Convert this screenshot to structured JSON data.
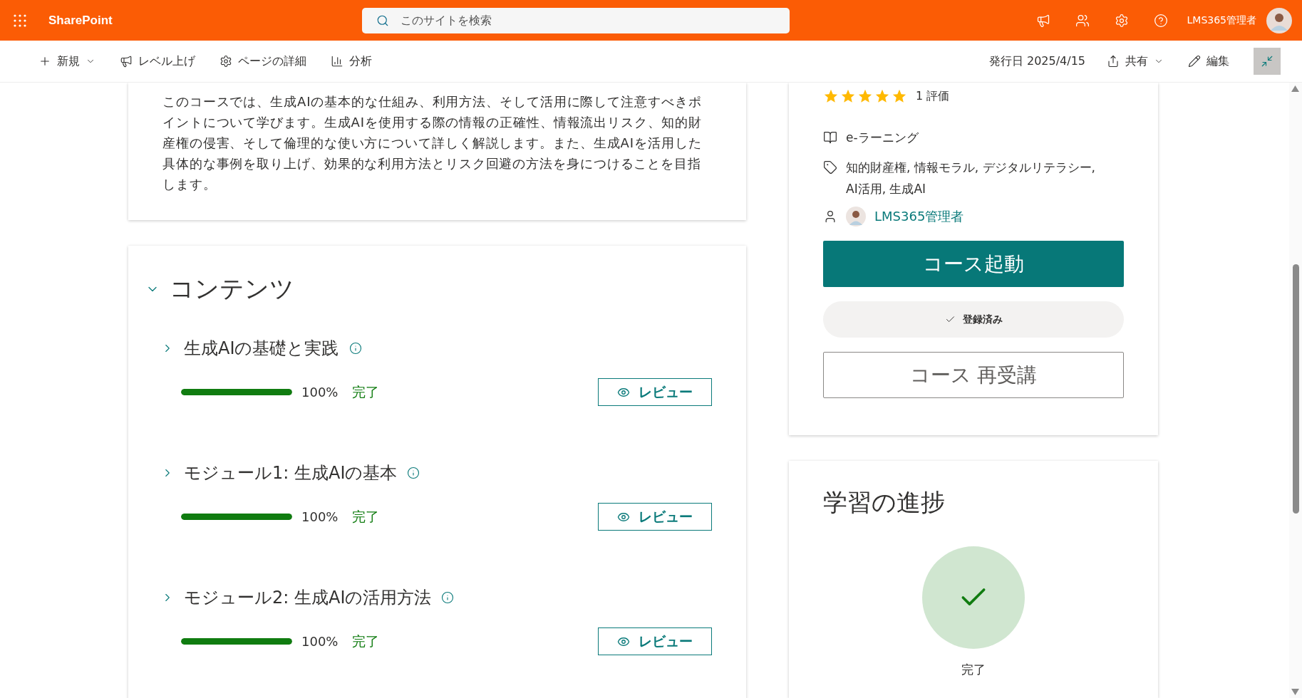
{
  "header": {
    "app_name": "SharePoint",
    "search_placeholder": "このサイトを検索",
    "user_name": "LMS365管理者"
  },
  "command_bar": {
    "left": [
      {
        "kind": "new",
        "label": "新規",
        "dropdown": true
      },
      {
        "kind": "promote",
        "label": "レベル上げ",
        "dropdown": false
      },
      {
        "kind": "details",
        "label": "ページの詳細",
        "dropdown": false
      },
      {
        "kind": "analytics",
        "label": "分析",
        "dropdown": false
      }
    ],
    "published": "発行日 2025/4/15",
    "share": "共有",
    "edit": "編集"
  },
  "description": "このコースでは、生成AIの基本的な仕組み、利用方法、そして活用に際して注意すべきポイントについて学びます。生成AIを使用する際の情報の正確性、情報流出リスク、知的財産権の侵害、そして倫理的な使い方について詳しく解説します。また、生成AIを活用した具体的な事例を取り上げ、効果的な利用方法とリスク回避の方法を身につけることを目指します。",
  "contents": {
    "title": "コンテンツ",
    "expanded": true,
    "modules": [
      {
        "title": "生成AIの基礎と実践",
        "level": 1,
        "percent": "100%",
        "status": "完了",
        "button": "レビュー"
      },
      {
        "title": "モジュール1: 生成AIの基本",
        "level": 1,
        "percent": "100%",
        "status": "完了",
        "button": "レビュー"
      },
      {
        "title": "モジュール2: 生成AIの活用方法",
        "level": 1,
        "percent": "100%",
        "status": "完了",
        "button": "レビュー"
      }
    ]
  },
  "course_info": {
    "stars": 5,
    "rating_text": "1 評価",
    "type": "e-ラーニング",
    "tags": "知的財産権, 情報モラル, デジタルリテラシー, AI活用, 生成AI",
    "author": "LMS365管理者",
    "launch_button": "コース起動",
    "enrolled": {
      "label": "登録済み",
      "checked": true
    },
    "retake_button": "コース 再受講"
  },
  "progress": {
    "title": "学習の進捗",
    "completed": true,
    "status": "完了"
  }
}
